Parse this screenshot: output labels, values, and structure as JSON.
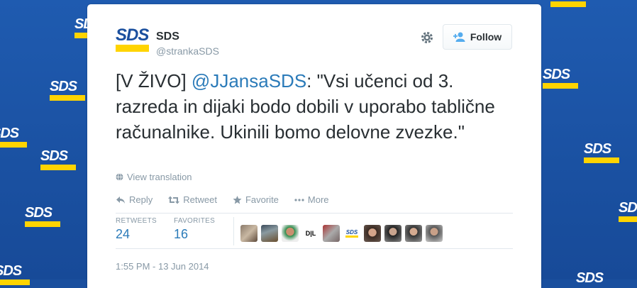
{
  "account": {
    "logo_text": "SDS",
    "name": "SDS",
    "handle": "@strankaSDS"
  },
  "follow_label": "Follow",
  "tweet": {
    "prefix": "[V ŽIVO] ",
    "mention": "@JJansaSDS",
    "body": ": \"Vsi učenci od 3. razreda in dijaki bodo dobili v uporabo tablične računalnike. Ukinili bomo delovne zvezke.\""
  },
  "view_translation": "View translation",
  "actions": {
    "reply": "Reply",
    "retweet": "Retweet",
    "favorite": "Favorite",
    "more": "More"
  },
  "stats": {
    "retweets_label": "RETWEETS",
    "retweets": "24",
    "favorites_label": "FAVORITES",
    "favorites": "16"
  },
  "favoriter_avatars": 10,
  "timestamp": "1:55 PM - 13 Jun 2014",
  "colors": {
    "accent": "#2b7bb9",
    "brand_blue": "#1a4f9e",
    "brand_yellow": "#ffd400"
  }
}
